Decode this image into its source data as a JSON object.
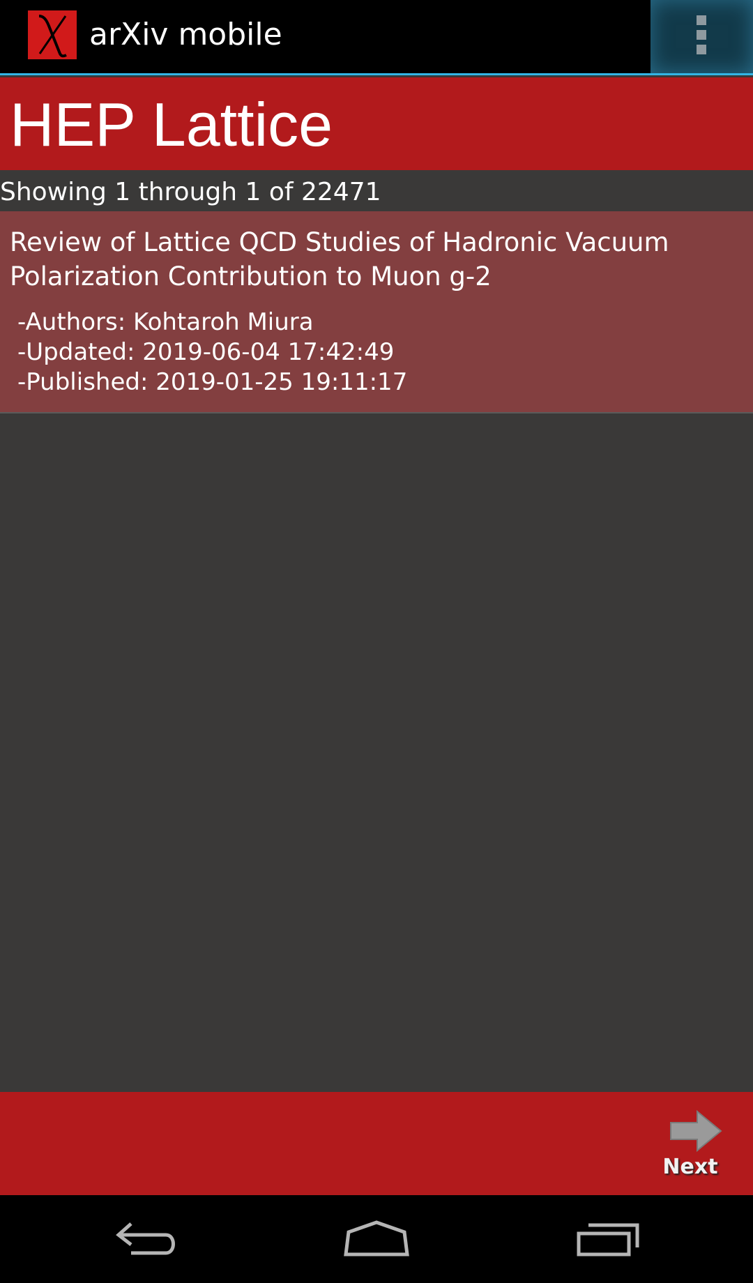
{
  "app": {
    "title": "arXiv mobile",
    "logo_icon": "chi-logo-icon",
    "logo_color": "#d11a1a"
  },
  "action_bar": {
    "overflow_icon": "overflow-menu-icon",
    "accent_color": "#33b5e5"
  },
  "category": {
    "title": "HEP Lattice",
    "color": "#b21a1c"
  },
  "results": {
    "showing_text": "Showing 1 through 1 of 22471"
  },
  "articles": [
    {
      "title": "Review of Lattice QCD Studies of Hadronic Vacuum Polarization Contribution to Muon g-2",
      "authors": "-Authors: Kohtaroh Miura",
      "updated": "-Updated: 2019-06-04 17:42:49",
      "published": "-Published: 2019-01-25 19:11:17"
    }
  ],
  "bottom_bar": {
    "next_label": "Next",
    "next_icon": "arrow-right-icon"
  },
  "nav_bar": {
    "back_icon": "back-icon",
    "home_icon": "home-icon",
    "recents_icon": "recents-icon"
  }
}
